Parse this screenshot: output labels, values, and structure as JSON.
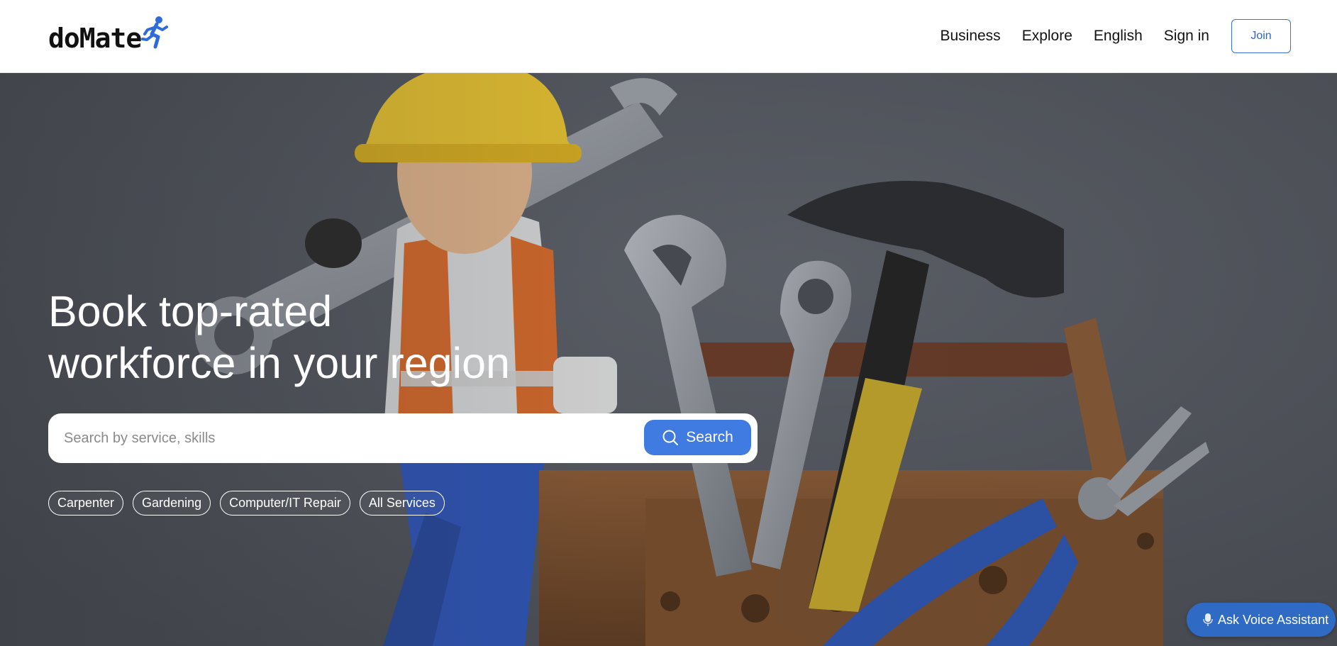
{
  "brand": {
    "name": "doMate",
    "logo_icon": "running-person-icon",
    "accent": "#2f63cf"
  },
  "nav": {
    "items": [
      "Business",
      "Explore",
      "English",
      "Sign in"
    ],
    "join_label": "Join"
  },
  "hero": {
    "headline_line1": "Book top-rated",
    "headline_line2": "workforce in your region",
    "search": {
      "placeholder": "Search by service, skills",
      "value": "",
      "button_label": "Search",
      "button_icon": "search-icon"
    },
    "chips": [
      "Carpenter",
      "Gardening",
      "Computer/IT Repair",
      "All Services"
    ],
    "background": "illustration of worker with wrench beside toolbox with hammer, spanners and pliers"
  },
  "voice_assistant": {
    "label": "Ask Voice Assistant",
    "icon": "microphone-icon",
    "color": "#2f6bc4"
  }
}
